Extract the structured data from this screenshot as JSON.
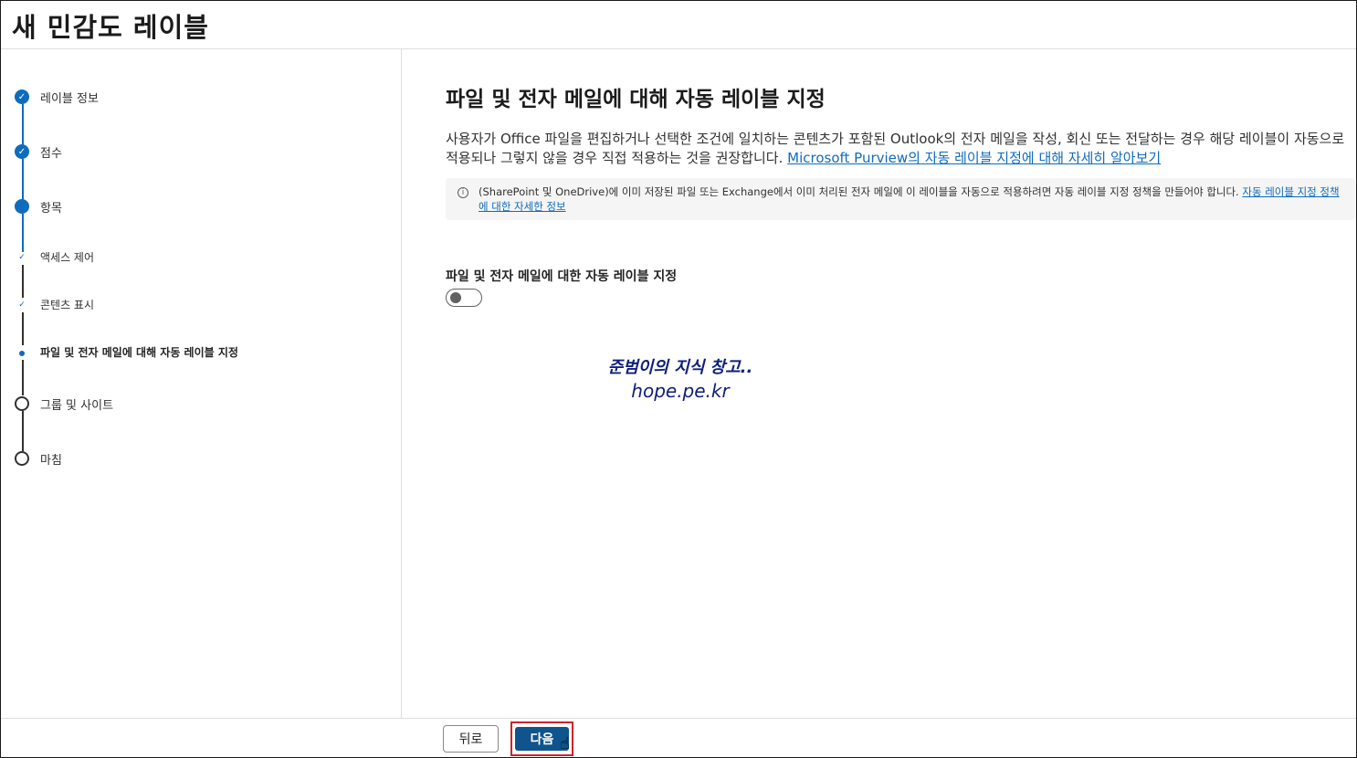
{
  "window": {
    "title": "새 민감도 레이블"
  },
  "steps": [
    {
      "label": "레이블 정보",
      "status": "done"
    },
    {
      "label": "점수",
      "status": "done"
    },
    {
      "label": "항목",
      "status": "current"
    },
    {
      "label": "액세스 제어",
      "status": "sub-done"
    },
    {
      "label": "콘텐츠 표시",
      "status": "sub-done"
    },
    {
      "label": "파일 및 전자 메일에 대해 자동 레이블 지정",
      "status": "sub-current"
    },
    {
      "label": "그룹 및 사이트",
      "status": "pending"
    },
    {
      "label": "마침",
      "status": "pending"
    }
  ],
  "main": {
    "heading": "파일 및 전자 메일에 대해 자동 레이블 지정",
    "description": "사용자가 Office 파일을 편집하거나 선택한 조건에 일치하는 콘텐츠가 포함된 Outlook의 전자 메일을 작성, 회신 또는 전달하는 경우 해당 레이블이 자동으로 적용되나 그렇지 않을 경우 직접 적용하는 것을 권장합니다.",
    "description_link": "Microsoft Purview의 자동 레이블 지정에 대해 자세히 알아보기",
    "info_text": "(SharePoint 및 OneDrive)에 이미 저장된 파일 또는 Exchange에서 이미 처리된 전자 메일에 이 레이블을 자동으로 적용하려면 자동 레이블 지정 정책을 만들어야 합니다.",
    "info_link": "자동 레이블 지정 정책에 대한 자세한 정보",
    "toggle_label": "파일 및 전자 메일에 대한 자동 레이블 지정",
    "toggle_on": false
  },
  "watermark": {
    "line1": "준범이의 지식 창고..",
    "line2": "hope.pe.kr"
  },
  "footer": {
    "back_label": "뒤로",
    "next_label": "다음"
  },
  "colors": {
    "accent": "#0f6cbd",
    "primary_button": "#0f548c",
    "highlight_box": "#d1222b"
  },
  "icons": {
    "done": "check-circle-icon",
    "info": "info-icon",
    "cursor": "hand-cursor-icon"
  }
}
